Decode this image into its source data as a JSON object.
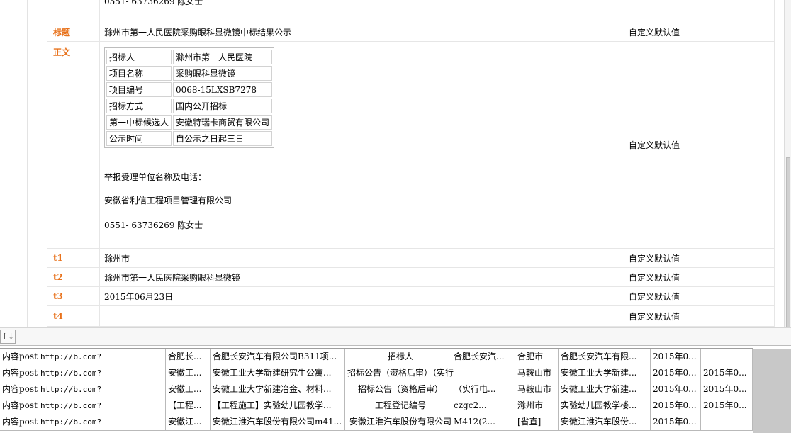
{
  "form": {
    "top_cut_text": "0551- 63736269 陈女士",
    "rows": {
      "title": {
        "label": "标题",
        "value": "滁州市第一人民医院采购眼科显微镜中标结果公示",
        "default": "自定义默认值"
      },
      "body": {
        "label": "正文",
        "default": "自定义默认值",
        "table": [
          {
            "key": "招标人",
            "val": "滁州市第一人民医院"
          },
          {
            "key": "项目名称",
            "val": "采购眼科显微镜"
          },
          {
            "key": "项目编号",
            "val": "0068-15LXSB7278"
          },
          {
            "key": "招标方式",
            "val": "国内公开招标"
          },
          {
            "key": "第一中标候选人",
            "val": "安徽特瑞卡商贸有限公司"
          },
          {
            "key": "公示时间",
            "val": "自公示之日起三日"
          }
        ],
        "report_label": "举报受理单位名称及电话：",
        "company": "安徽省利信工程项目管理有限公司",
        "phone": "0551- 63736269 陈女士"
      },
      "t1": {
        "label": "t1",
        "value": "滁州市",
        "default": "自定义默认值"
      },
      "t2": {
        "label": "t2",
        "value": "滁州市第一人民医院采购眼科显微镜",
        "default": "自定义默认值"
      },
      "t3": {
        "label": "t3",
        "value": "2015年06月23日",
        "default": "自定义默认值"
      },
      "t4": {
        "label": "t4",
        "value": "",
        "default": "自定义默认值"
      }
    }
  },
  "toolbar": {
    "sort_label": "↑↓"
  },
  "grid_rows": [
    {
      "c1": "内容post",
      "c2": "http://b.com?",
      "c3": "合肥长...",
      "c4": "合肥长安汽车有限公司B311项...",
      "c5": "招标人",
      "c6": "合肥长安汽...",
      "c7": "合肥市",
      "c8": "合肥长安汽车有限...",
      "c9": "2015年0...",
      "c10": ""
    },
    {
      "c1": "内容post",
      "c2": "http://b.com?",
      "c3": "安徽工...",
      "c4": "安徽工业大学新建研究生公寓...",
      "c5": "招标公告（资格后审）（实行电子...",
      "c6": "",
      "c7": "马鞍山市",
      "c8": "安徽工业大学新建...",
      "c9": "2015年0...",
      "c10": "2015年0..."
    },
    {
      "c1": "内容post",
      "c2": "http://b.com?",
      "c3": "安徽工...",
      "c4": "安徽工业大学新建冶金、材料...",
      "c5": "招标公告（资格后审）",
      "c6": "（实行电...",
      "c7": "马鞍山市",
      "c8": "安徽工业大学新建...",
      "c9": "2015年0...",
      "c10": "2015年0..."
    },
    {
      "c1": "内容post",
      "c2": "http://b.com?",
      "c3": "【工程...",
      "c4": "【工程施工】实验幼儿园教学...",
      "c5": "工程登记编号",
      "c6": "czgc2...",
      "c7": "滁州市",
      "c8": "实验幼儿园教学楼...",
      "c9": "2015年0...",
      "c10": "2015年0..."
    },
    {
      "c1": "内容post",
      "c2": "http://b.com?",
      "c3": "安徽江...",
      "c4": "安徽江淮汽车股份有限公司m41...",
      "c5": "安徽江淮汽车股份有限公司",
      "c6": "M412(2...",
      "c7": "[省直]",
      "c8": "安徽江淮汽车股份...",
      "c9": "2015年0...",
      "c10": ""
    }
  ]
}
